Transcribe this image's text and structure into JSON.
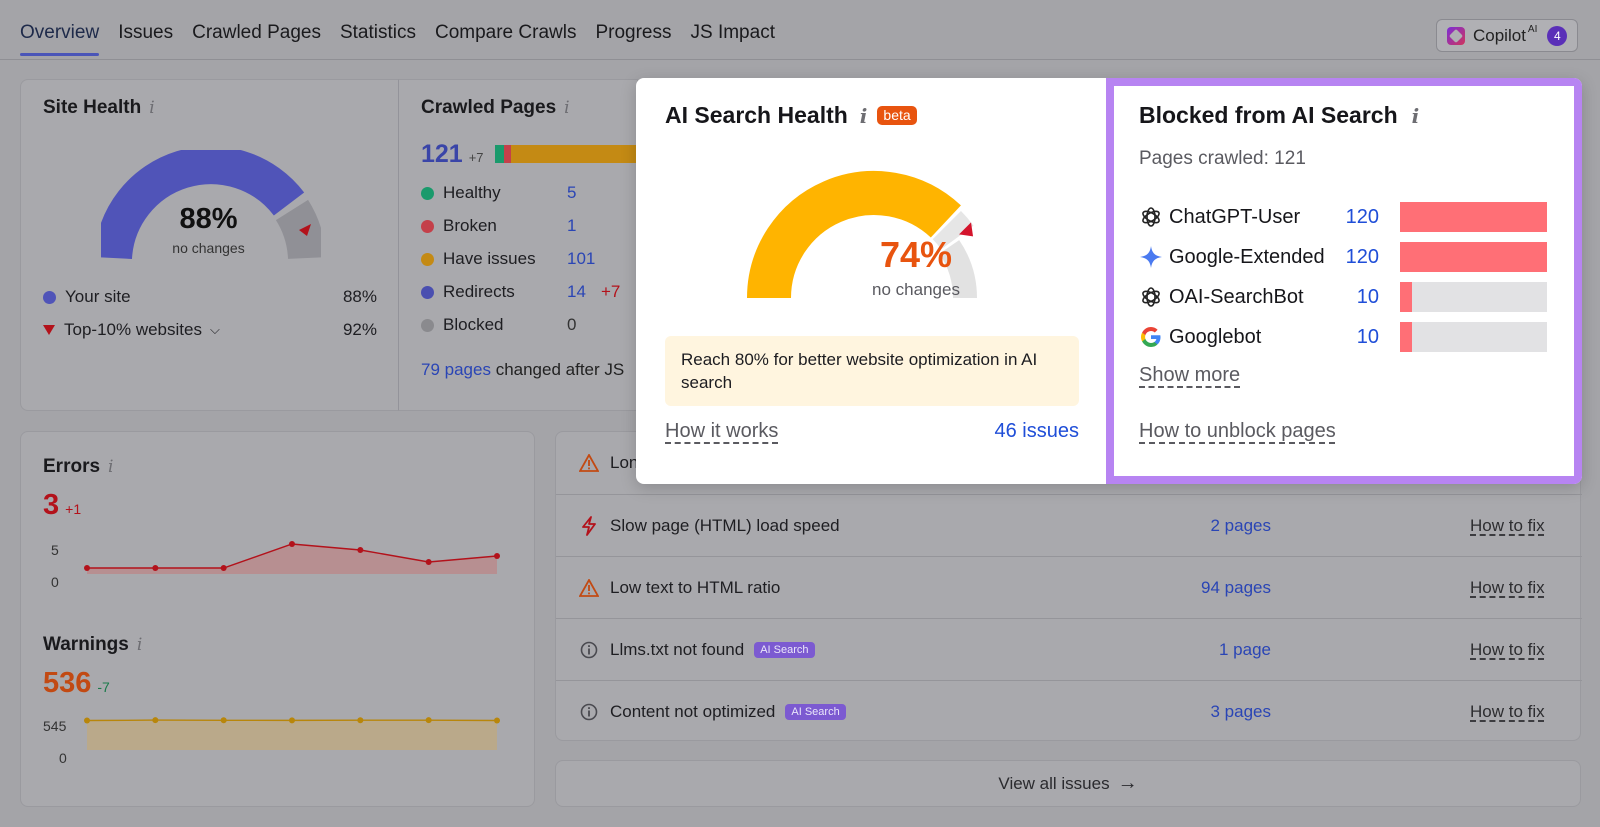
{
  "nav": {
    "tabs": [
      "Overview",
      "Issues",
      "Crawled Pages",
      "Statistics",
      "Compare Crawls",
      "Progress",
      "JS Impact"
    ],
    "copilot": {
      "label": "Copilot",
      "sup": "AI",
      "badge": "4"
    }
  },
  "site_health": {
    "title": "Site Health",
    "percent": "88%",
    "sub": "no changes",
    "legend": [
      {
        "label": "Your site",
        "value": "88%",
        "color": "#5054b8"
      },
      {
        "label": "Top-10% websites",
        "value": "92%",
        "color": "#b3121b"
      }
    ]
  },
  "crawled_pages": {
    "title": "Crawled Pages",
    "total": "121",
    "delta": "+7",
    "rows": [
      {
        "label": "Healthy",
        "value": "5",
        "color": "#1a9a6c"
      },
      {
        "label": "Broken",
        "value": "1",
        "color": "#c4404a"
      },
      {
        "label": "Have issues",
        "value": "101",
        "color": "#c48a14"
      },
      {
        "label": "Redirects",
        "value": "14",
        "delta": "+7",
        "color": "#4a4fb0"
      },
      {
        "label": "Blocked",
        "value": "0",
        "color": "#8a8a8e"
      }
    ],
    "changed_link": "79 pages",
    "changed_text": "changed after JS"
  },
  "errors": {
    "title": "Errors",
    "value": "3",
    "delta": "+1",
    "axis": [
      "5",
      "0"
    ],
    "points": [
      1,
      1,
      1,
      5,
      4,
      2,
      3
    ]
  },
  "warnings": {
    "title": "Warnings",
    "value": "536",
    "delta": "-7",
    "axis": [
      "545",
      "0"
    ],
    "points": [
      536,
      543,
      540,
      538,
      541,
      542,
      536
    ]
  },
  "issues": [
    {
      "label": "Long",
      "pages": "",
      "fix": "",
      "icon": "warning-icon",
      "tag": ""
    },
    {
      "label": "Slow page (HTML) load speed",
      "pages": "2 pages",
      "fix": "How to fix",
      "icon": "lightning-icon",
      "tag": ""
    },
    {
      "label": "Low text to HTML ratio",
      "pages": "94 pages",
      "fix": "How to fix",
      "icon": "warning-icon",
      "tag": ""
    },
    {
      "label": "Llms.txt not found",
      "pages": "1 page",
      "fix": "How to fix",
      "icon": "info-circle-icon",
      "tag": "AI Search"
    },
    {
      "label": "Content not optimized",
      "pages": "3 pages",
      "fix": "How to fix",
      "icon": "info-circle-icon",
      "tag": "AI Search"
    }
  ],
  "view_all": "View all issues",
  "ai_health": {
    "title": "AI Search Health",
    "beta": "beta",
    "percent": "74%",
    "percent_value": 0.74,
    "sub": "no changes",
    "tip": "Reach 80% for better website optimization in AI search",
    "how_it_works": "How it works",
    "issues_link": "46 issues"
  },
  "blocked": {
    "title": "Blocked from AI Search",
    "pages_crawled": "Pages crawled: 121",
    "bots": [
      {
        "name": "ChatGPT-User",
        "value": "120",
        "fraction": 1.0,
        "icon": "openai-icon"
      },
      {
        "name": "Google-Extended",
        "value": "120",
        "fraction": 1.0,
        "icon": "gemini-icon"
      },
      {
        "name": "OAI-SearchBot",
        "value": "10",
        "fraction": 0.083,
        "icon": "openai-icon"
      },
      {
        "name": "Googlebot",
        "value": "10",
        "fraction": 0.083,
        "icon": "google-icon"
      }
    ],
    "show_more": "Show more",
    "how_to_unblock": "How to unblock pages"
  },
  "colors": {
    "accent_orange": "#e8540f",
    "blocked_border": "#b784f2",
    "gauge_fill": "#ffb400",
    "bar_red": "#ff6f76",
    "link_blue": "#1f4ed8"
  }
}
